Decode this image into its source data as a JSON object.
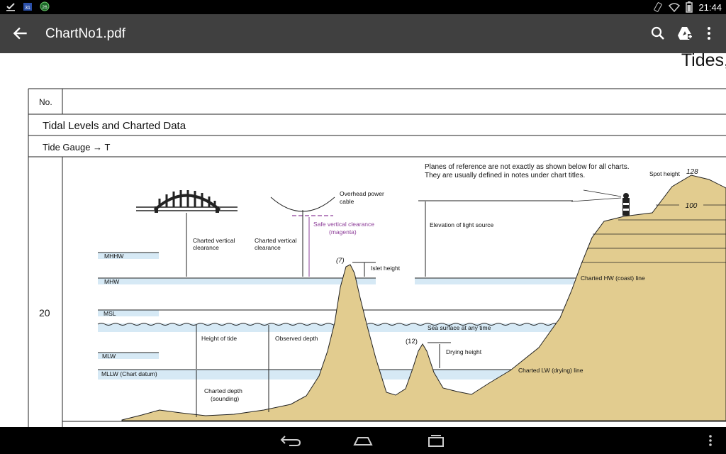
{
  "status_bar": {
    "time": "21:44",
    "notification_icons": [
      "check-icon",
      "calendar-icon",
      "badge-icon"
    ],
    "badge_numbers": {
      "calendar": "31",
      "badge": "26"
    }
  },
  "app_bar": {
    "title": "ChartNo1.pdf",
    "actions": [
      "search-icon",
      "drive-add-icon",
      "overflow-menu-icon"
    ]
  },
  "document": {
    "section_title": "Tides,",
    "table": {
      "header_no": "No.",
      "heading": "Tidal Levels and Charted Data",
      "subheading": "Tide Gauge → T",
      "row_number": "20"
    },
    "figure": {
      "note_line1": "Planes of reference are not exactly as shown below for all charts.",
      "note_line2": "They are usually defined in notes under chart titles.",
      "spot_height_label": "Spot height",
      "spot_height_value": "128",
      "contour_value": "100",
      "overhead_cable_1": "Overhead power",
      "overhead_cable_2": "cable",
      "safe_clearance_1": "Safe vertical clearance",
      "safe_clearance_2": "(magenta)",
      "charted_clearance_1": "Charted vertical",
      "charted_clearance_2": "clearance",
      "elevation_light": "Elevation of light source",
      "islet_value": "(7)",
      "islet_height": "Islet height",
      "drying_value": "(12)",
      "drying_height": "Drying height",
      "charted_hw_line": "Charted HW (coast) line",
      "charted_lw_line": "Charted LW (drying) line",
      "sea_surface": "Sea surface at any time",
      "height_of_tide": "Height of tide",
      "observed_depth": "Observed depth",
      "charted_depth_1": "Charted depth",
      "charted_depth_2": "(sounding)",
      "levels": [
        "MHHW",
        "MHW",
        "MSL",
        "MLW",
        "MLLW (Chart datum)"
      ]
    }
  },
  "colors": {
    "land": "#e2cc8f",
    "water_band": "#d6e9f5",
    "magenta": "#8e3f9a",
    "app_bar": "#404040"
  }
}
